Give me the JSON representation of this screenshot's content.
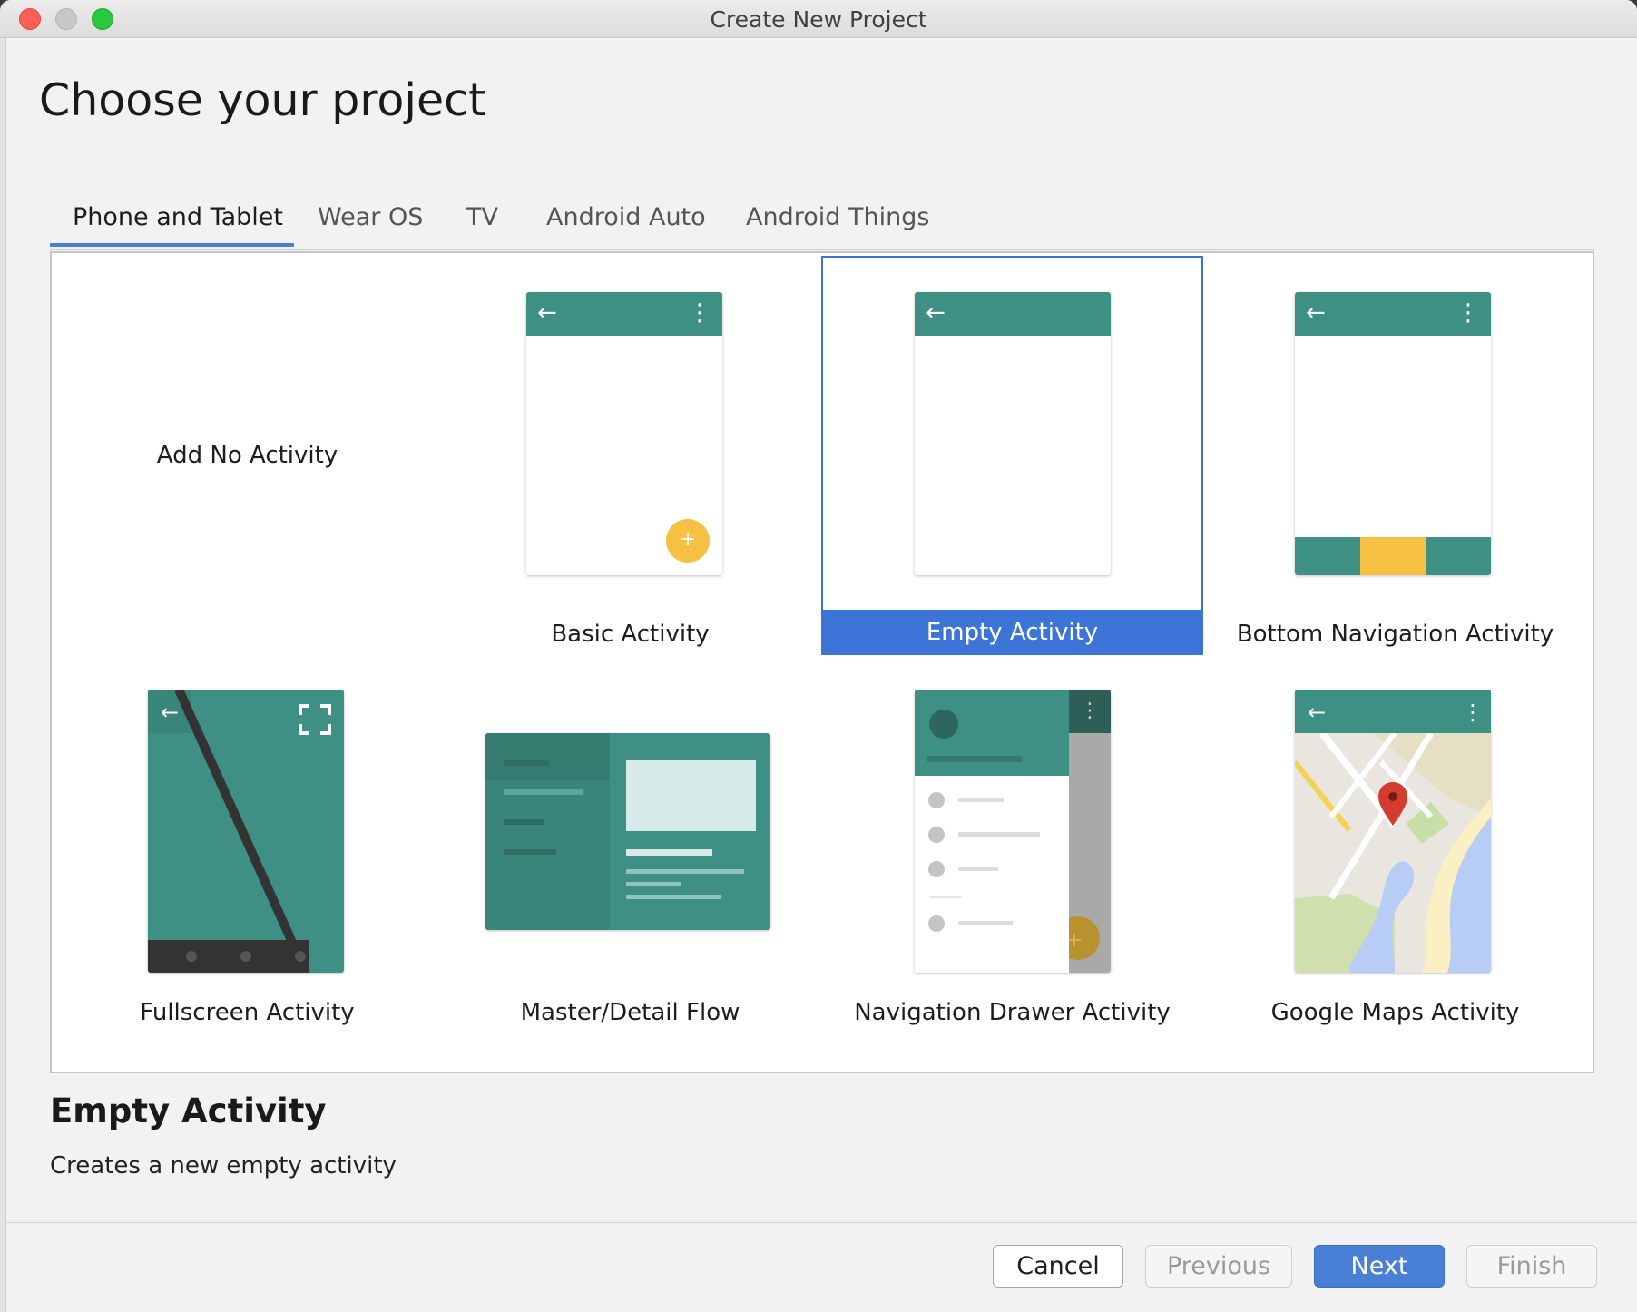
{
  "window": {
    "title": "Create New Project"
  },
  "page": {
    "title": "Choose your project"
  },
  "tabs": [
    {
      "label": "Phone and Tablet",
      "active": true
    },
    {
      "label": "Wear OS",
      "active": false
    },
    {
      "label": "TV",
      "active": false
    },
    {
      "label": "Android Auto",
      "active": false
    },
    {
      "label": "Android Things",
      "active": false
    }
  ],
  "templates": [
    {
      "label": "Add No Activity",
      "selected": false
    },
    {
      "label": "Basic Activity",
      "selected": false
    },
    {
      "label": "Empty Activity",
      "selected": true
    },
    {
      "label": "Bottom Navigation Activity",
      "selected": false
    },
    {
      "label": "Fullscreen Activity",
      "selected": false
    },
    {
      "label": "Master/Detail Flow",
      "selected": false
    },
    {
      "label": "Navigation Drawer Activity",
      "selected": false
    },
    {
      "label": "Google Maps Activity",
      "selected": false
    }
  ],
  "description": {
    "title": "Empty Activity",
    "text": "Creates a new empty activity"
  },
  "buttons": {
    "cancel": "Cancel",
    "previous": "Previous",
    "next": "Next",
    "finish": "Finish"
  },
  "icons": {
    "back": "arrow-left-icon",
    "more": "vertical-dots-icon",
    "fab": "plus-icon",
    "fullscreen": "fullscreen-icon",
    "map_marker": "map-pin-icon"
  },
  "colors": {
    "accent_blue": "#4a7fd6",
    "selection_blue": "#3c74d8",
    "template_teal": "#3f9084",
    "fab_yellow": "#f6c142"
  }
}
